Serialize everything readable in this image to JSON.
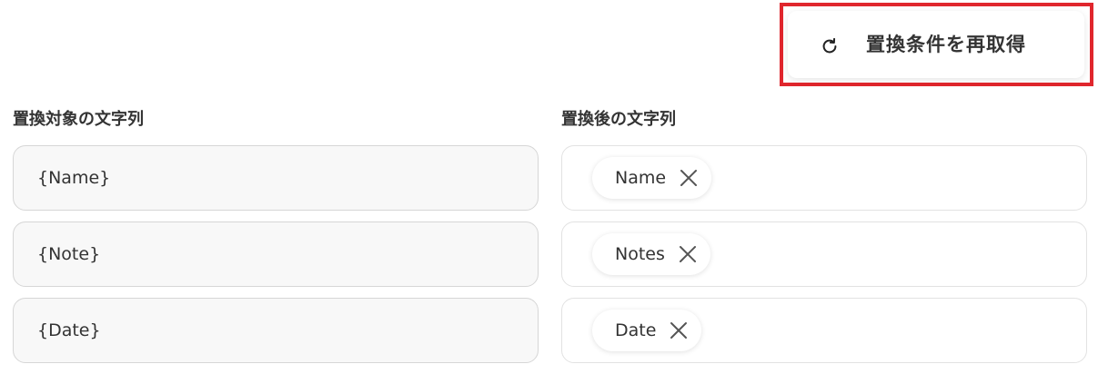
{
  "refresh": {
    "label": "置換条件を再取得",
    "icon": "refresh-icon"
  },
  "source_column": {
    "label": "置換対象の文字列"
  },
  "target_column": {
    "label": "置換後の文字列"
  },
  "rows": [
    {
      "source": "{Name}",
      "target_chip": "Name"
    },
    {
      "source": "{Note}",
      "target_chip": "Notes"
    },
    {
      "source": "{Date}",
      "target_chip": "Date"
    }
  ],
  "colors": {
    "highlight": "#e0262d",
    "text": "#333333"
  }
}
